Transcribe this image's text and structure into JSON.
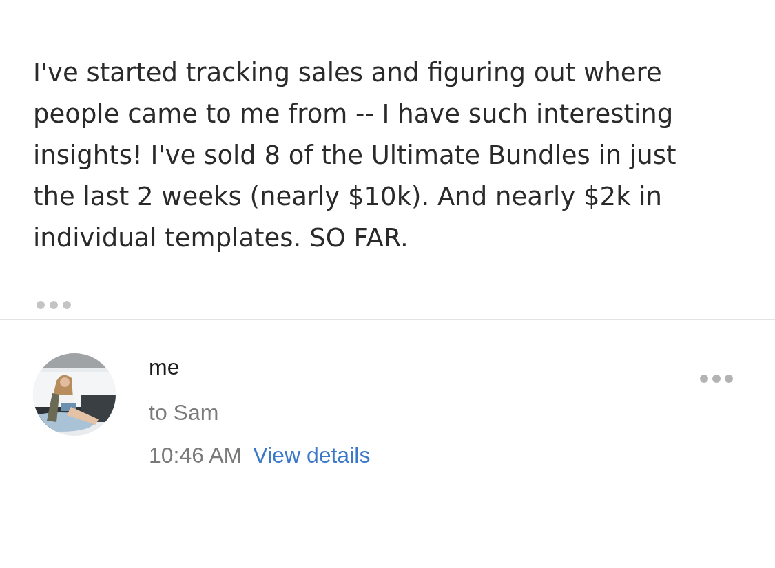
{
  "message_body": {
    "text": "I've started tracking sales and figuring out where people came to me from -- I have such interesting insights! I've sold 8 of the Ultimate Bundles in just the last 2 weeks (nearly $10k). And nearly $2k in individual templates. SO FAR."
  },
  "reply": {
    "sender": "me",
    "recipient": "to Sam",
    "time": "10:46 AM",
    "details_link": "View details"
  }
}
